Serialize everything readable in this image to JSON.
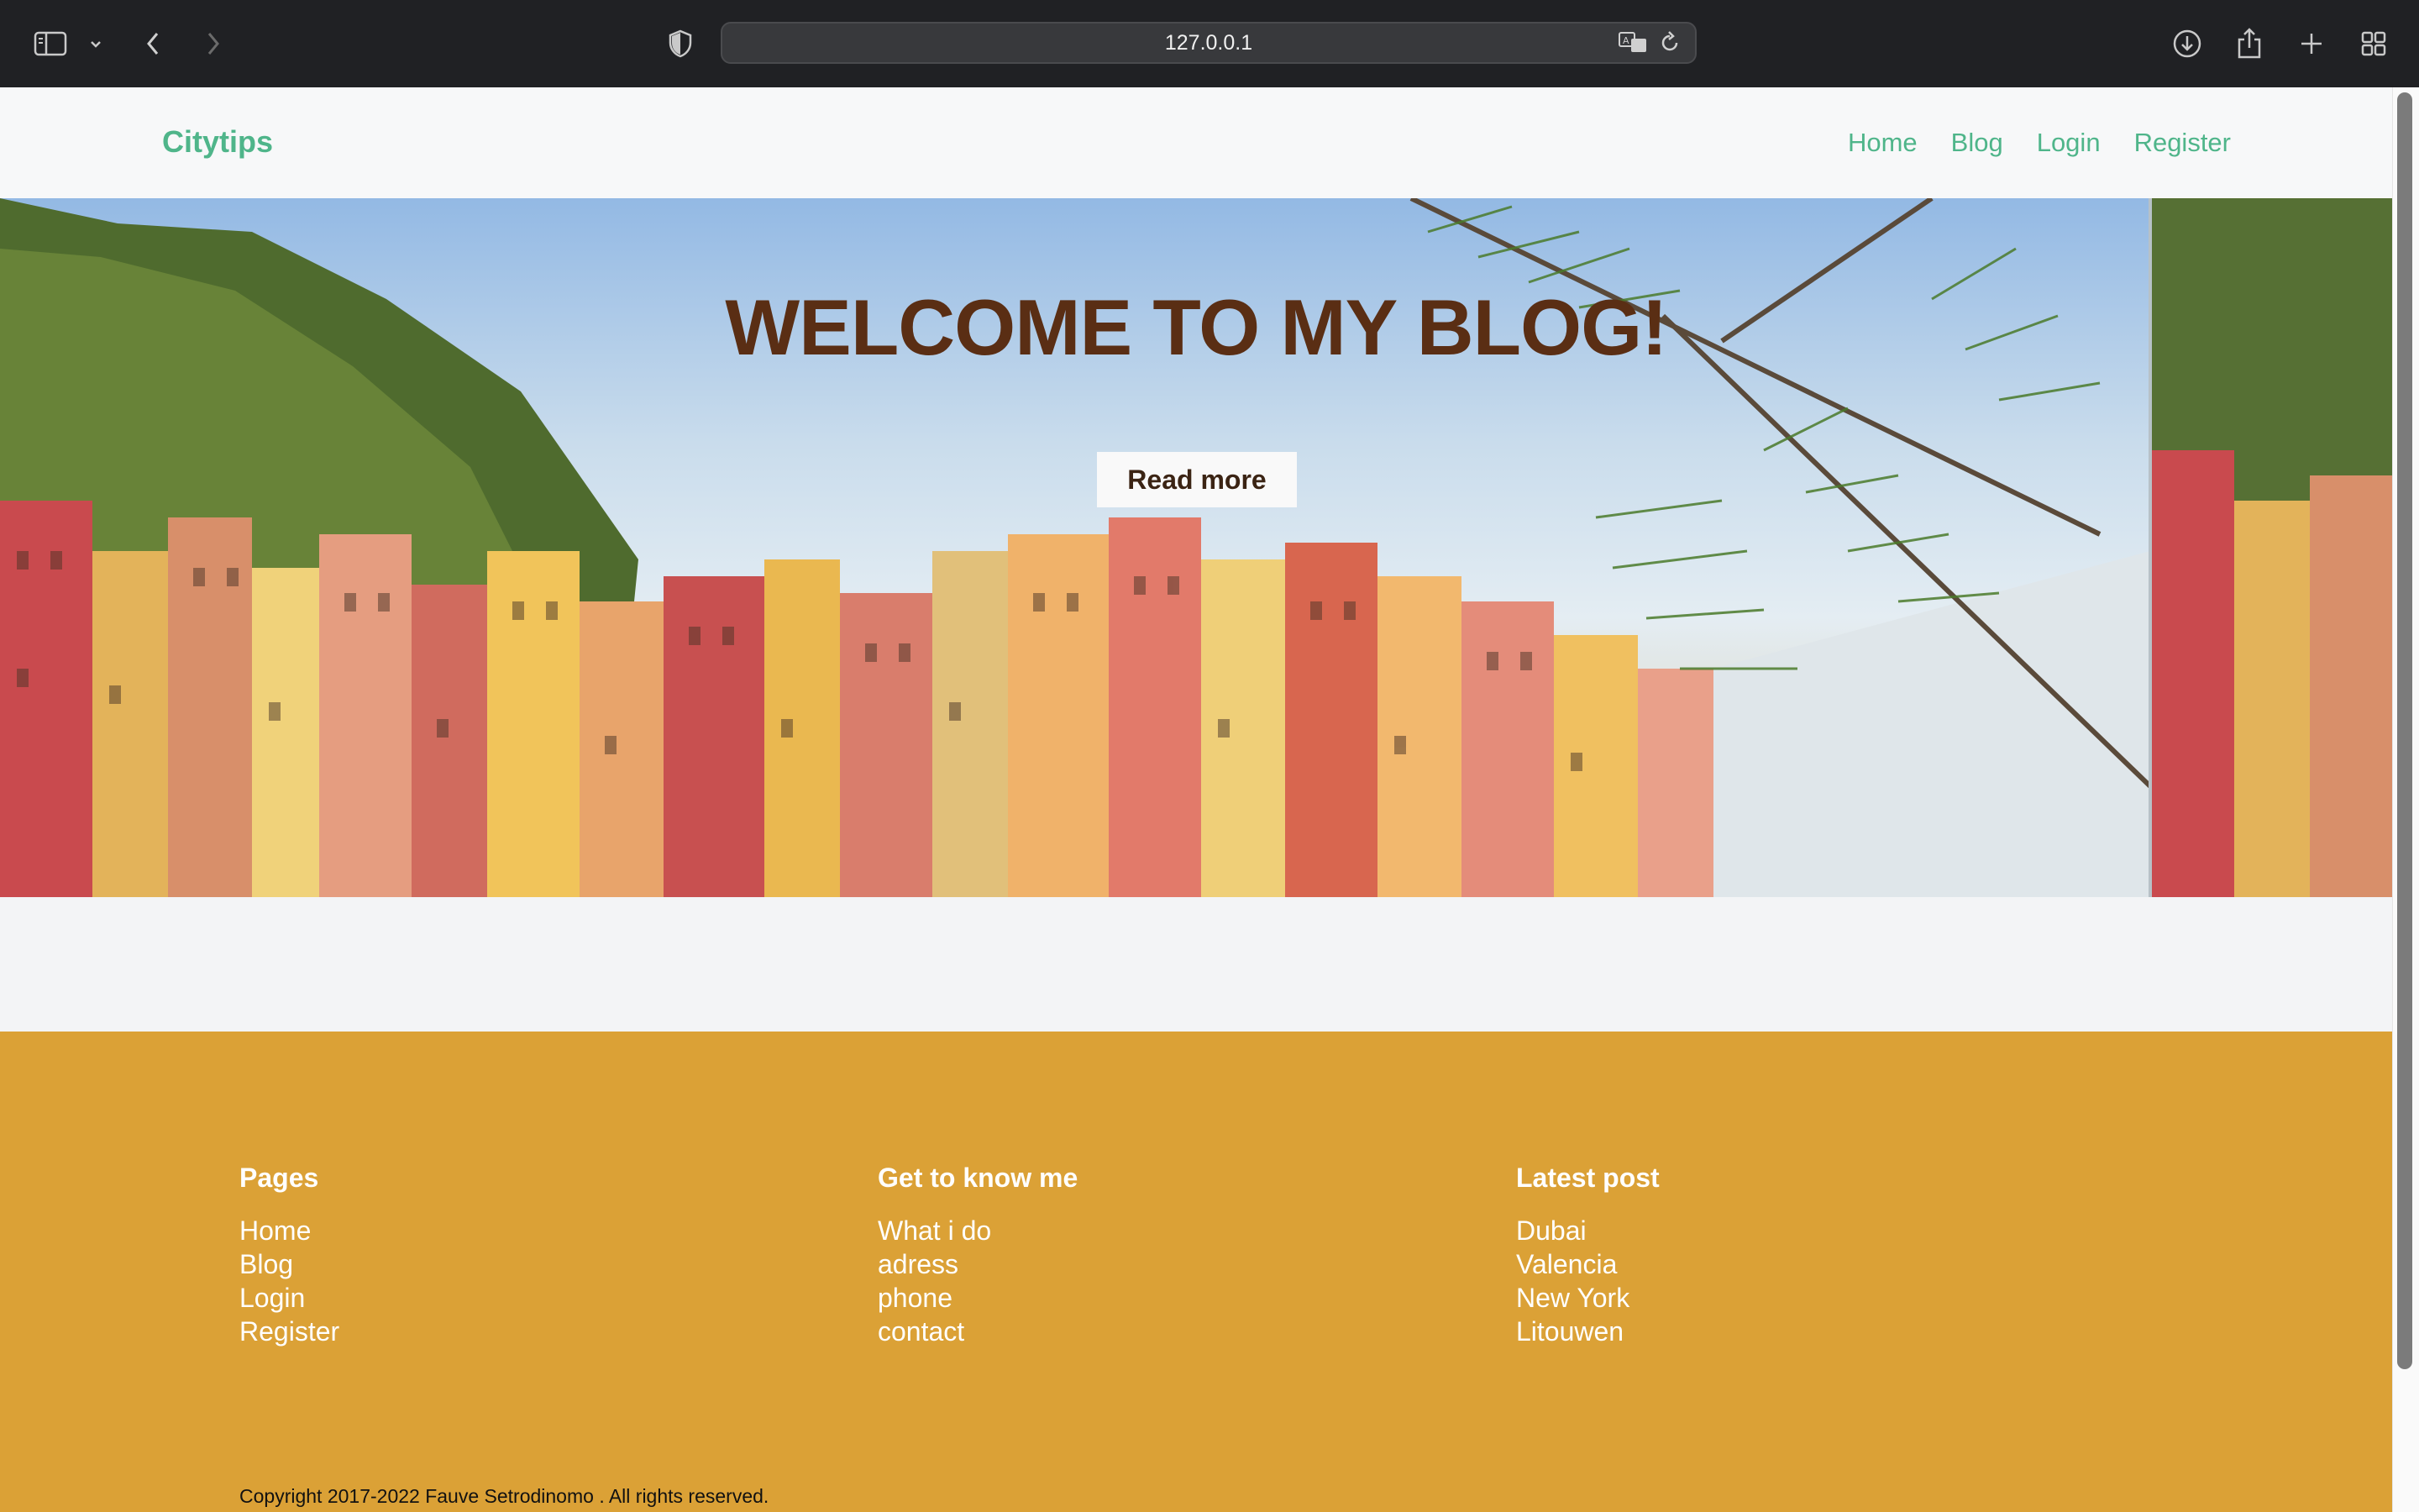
{
  "browser": {
    "url": "127.0.0.1"
  },
  "site": {
    "brand": "Citytips",
    "nav": [
      "Home",
      "Blog",
      "Login",
      "Register"
    ]
  },
  "hero": {
    "title": "WELCOME TO MY BLOG!",
    "button": "Read more"
  },
  "footer": {
    "columns": [
      {
        "title": "Pages",
        "links": [
          "Home",
          "Blog",
          "Login",
          "Register"
        ]
      },
      {
        "title": "Get to know me",
        "links": [
          "What i do",
          "adress",
          "phone",
          "contact"
        ]
      },
      {
        "title": "Latest post",
        "links": [
          "Dubai",
          "Valencia",
          "New York",
          "Litouwen"
        ]
      }
    ],
    "copyright": "Copyright 2017-2022 Fauve Setrodinomo . All rights reserved."
  },
  "colors": {
    "brand": "#4fb58a",
    "footer_bg": "#dba136",
    "hero_title": "#5a2e14"
  }
}
